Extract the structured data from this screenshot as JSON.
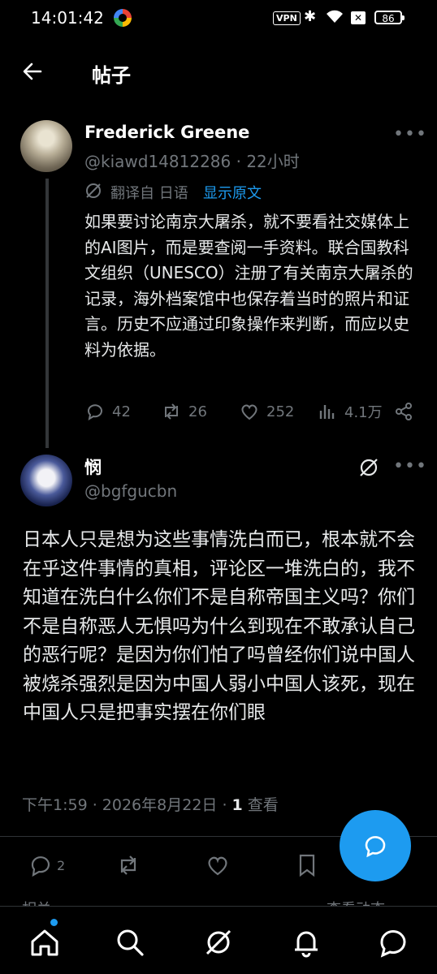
{
  "status_bar": {
    "time": "14:01:42",
    "vpn": "VPN",
    "battery": "86"
  },
  "header": {
    "title": "帖子"
  },
  "original_post": {
    "author_name": "Frederick Greene",
    "handle_time": "@kiawd14812286 · 22小时",
    "translation_label": "翻译自 日语",
    "show_original": "显示原文",
    "text": "如果要讨论南京大屠杀，就不要看社交媒体上的AI图片，而是要查阅一手资料。联合国教科文组织（UNESCO）注册了有关南京大屠杀的记录，海外档案馆中也保存着当时的照片和证言。历史不应通过印象操作来判断，而应以史料为依据。",
    "replies": "42",
    "reposts": "26",
    "likes": "252",
    "views": "4.1万"
  },
  "reply_post": {
    "author_name": "悯",
    "handle": "@bgfgucbn",
    "text": "日本人只是想为这些事情洗白而已，根本就不会在乎这件事情的真相，评论区一堆洗白的，我不知道在洗白什么你们不是自称帝国主义吗？你们不是自称恶人无惧吗为什么到现在不敢承认自己的恶行呢？是因为你们怕了吗曾经你们说中国人被烧杀强烈是因为中国人弱小中国人该死，现在中国人只是把事实摆在你们眼",
    "timestamp": "下午1:59 · 2026年8月22日 · ",
    "views_count": "1",
    "views_label": " 查看",
    "replies": "2"
  },
  "footer_hints": {
    "related": "相关",
    "view_activity": "查看动态 ›"
  },
  "colors": {
    "accent": "#1d9bf0",
    "muted": "#71767b",
    "background": "#000000"
  },
  "icons": [
    "back-arrow-icon",
    "more-icon",
    "translate-icon",
    "reply-icon",
    "repost-icon",
    "like-icon",
    "views-icon",
    "share-icon",
    "grok-icon",
    "bookmark-icon",
    "home-icon",
    "search-icon",
    "notifications-icon",
    "messages-icon"
  ]
}
